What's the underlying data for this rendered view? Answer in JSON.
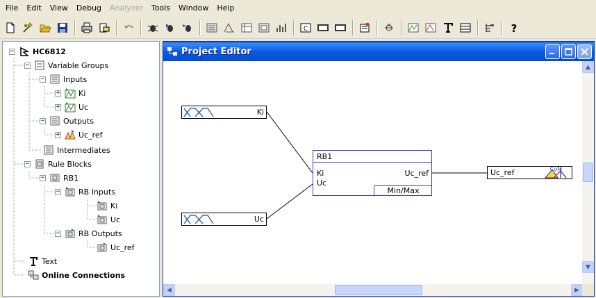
{
  "menu": {
    "items": [
      {
        "label": "File",
        "enabled": true
      },
      {
        "label": "Edit",
        "enabled": true
      },
      {
        "label": "View",
        "enabled": true
      },
      {
        "label": "Debug",
        "enabled": true
      },
      {
        "label": "Analyzer",
        "enabled": false
      },
      {
        "label": "Tools",
        "enabled": true
      },
      {
        "label": "Window",
        "enabled": true
      },
      {
        "label": "Help",
        "enabled": true
      }
    ]
  },
  "toolbar": {
    "buttons": [
      "new-icon",
      "wizard-icon",
      "open-icon",
      "save-icon",
      "print-icon",
      "print-preview-icon",
      "undo-icon",
      "debug-icon",
      "step-icon",
      "trace-icon",
      "rule-block-icon",
      "variable-icon",
      "spreadsheet-icon",
      "matrix-icon",
      "analyzer-icon",
      "c-code-icon",
      "mcu-icon",
      "mcu2-icon",
      "properties-icon",
      "online-icon",
      "variable-editor-icon",
      "term-editor-icon",
      "text-icon",
      "table-icon",
      "tree-icon",
      "help-icon"
    ]
  },
  "tree": {
    "root": "HC6812",
    "variable_groups": "Variable Groups",
    "inputs": "Inputs",
    "ki": "Ki",
    "uc": "Uc",
    "outputs": "Outputs",
    "uc_ref": "Uc_ref",
    "intermediates": "Intermediates",
    "rule_blocks": "Rule Blocks",
    "rb1": "RB1",
    "rb_inputs": "RB Inputs",
    "rb_ki": "Ki",
    "rb_uc": "Uc",
    "rb_outputs": "RB Outputs",
    "rb_uc_ref": "Uc_ref",
    "text": "Text",
    "online": "Online Connections"
  },
  "editor": {
    "title": "Project Editor",
    "input_ki": "Ki",
    "input_uc": "Uc",
    "rule_block": {
      "name": "RB1",
      "in1": "Ki",
      "in2": "Uc",
      "out": "Uc_ref",
      "operator": "Min/Max"
    },
    "output": "Uc_ref",
    "output_badge": "CoM"
  },
  "colors": {
    "accent": "#0a5fd6",
    "rule_block_border": "#3a3ad0",
    "tree_border": "#7f9db9"
  }
}
